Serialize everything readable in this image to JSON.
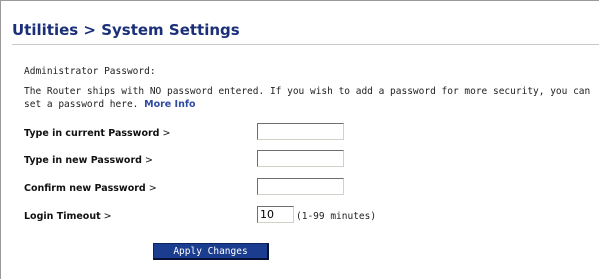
{
  "page": {
    "title": "Utilities > System Settings"
  },
  "admin": {
    "section_label": "Administrator Password:",
    "description": "The Router ships with NO password entered. If you wish to add a password for more security, you can set a password here.",
    "more_info_label": "More Info"
  },
  "fields": {
    "current_password": {
      "label": "Type in current Password",
      "suffix": ">",
      "value": ""
    },
    "new_password": {
      "label": "Type in new Password",
      "suffix": ">",
      "value": ""
    },
    "confirm_password": {
      "label": "Confirm new Password",
      "suffix": ">",
      "value": ""
    },
    "login_timeout": {
      "label": "Login Timeout",
      "suffix": ">",
      "value": "10",
      "hint": "(1-99 minutes)"
    }
  },
  "actions": {
    "apply_label": "Apply Changes"
  },
  "colors": {
    "title": "#1a2f78",
    "link": "#2f4aa0",
    "button_bg": "#1b3d8f",
    "button_text": "#ffffff"
  }
}
